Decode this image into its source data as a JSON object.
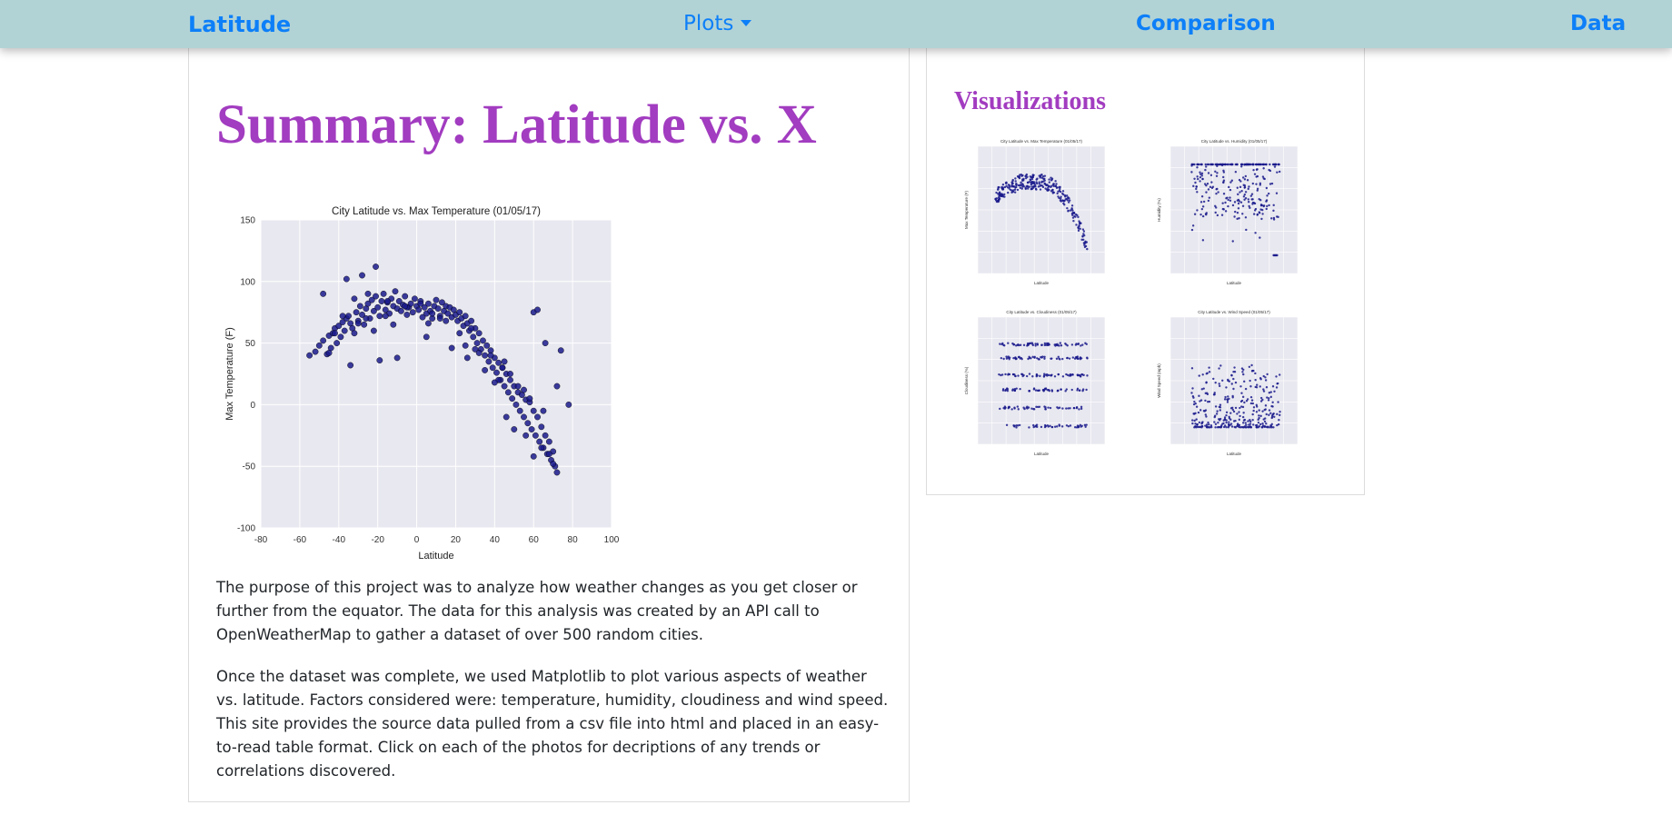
{
  "nav": {
    "brand": "Latitude",
    "plots_label": "Plots",
    "comparison_label": "Comparison",
    "data_label": "Data",
    "link_color": "#0d7ff8",
    "background": "#b2d3d5"
  },
  "summary": {
    "title": "Summary: Latitude vs. X",
    "title_color": "#a23cc0",
    "paragraph1": "The purpose of this project was to analyze how weather changes as you get closer or further from the equator. The data for this analysis was created by an API call to OpenWeatherMap to gather a dataset of over 500 random cities.",
    "paragraph2": "Once the dataset was complete, we used Matplotlib to plot various aspects of weather vs. latitude. Factors considered were: temperature, humidity, cloudiness and wind speed. This site provides the source data pulled from a csv file into html and placed in an easy-to-read table format. Click on each of the photos for decriptions of any trends or correlations discovered."
  },
  "visualizations": {
    "title": "Visualizations"
  },
  "chart_data": [
    {
      "type": "scatter",
      "title": "City Latitude vs. Max Temperature (01/05/17)",
      "xlabel": "Latitude",
      "ylabel": "Max Temperature (F)",
      "xlim": [
        -80,
        100
      ],
      "ylim": [
        -100,
        150
      ],
      "xticks": [
        -80,
        -60,
        -40,
        -20,
        0,
        20,
        40,
        60,
        80,
        100
      ],
      "yticks": [
        -100,
        -50,
        0,
        50,
        100,
        150
      ],
      "grid": true,
      "point_color": "#1a1a8c",
      "plot_background": "#e8e8f0",
      "x": [
        -55,
        -52,
        -50,
        -48,
        -46,
        -45,
        -44,
        -43,
        -42,
        -41,
        -40,
        -39,
        -38,
        -37,
        -36,
        -35,
        -34,
        -33,
        -32,
        -31,
        -30,
        -29,
        -28,
        -27,
        -26,
        -25,
        -24,
        -23,
        -22,
        -21,
        -20,
        -19,
        -18,
        -17,
        -16,
        -15,
        -14,
        -13,
        -12,
        -11,
        -10,
        -9,
        -8,
        -7,
        -6,
        -5,
        -4,
        -3,
        -2,
        -1,
        0,
        1,
        2,
        3,
        4,
        5,
        6,
        7,
        8,
        9,
        10,
        11,
        12,
        13,
        14,
        15,
        16,
        17,
        18,
        19,
        20,
        21,
        22,
        23,
        24,
        25,
        26,
        27,
        28,
        29,
        30,
        31,
        32,
        33,
        34,
        35,
        36,
        37,
        38,
        39,
        40,
        41,
        42,
        43,
        44,
        45,
        46,
        47,
        48,
        49,
        50,
        51,
        52,
        53,
        54,
        55,
        56,
        57,
        58,
        59,
        60,
        61,
        62,
        63,
        64,
        65,
        66,
        67,
        68,
        69,
        70,
        71,
        72,
        -36,
        -28,
        -21,
        -45,
        -34,
        -19,
        -10,
        5,
        25,
        45,
        60,
        62,
        72,
        78,
        55,
        50,
        42,
        35,
        30,
        65,
        68,
        58,
        48,
        38,
        28,
        15,
        8,
        -5,
        -15,
        -25,
        -30,
        -38,
        -42,
        -22,
        -12,
        2,
        12,
        22,
        32,
        44,
        52,
        64,
        70,
        74,
        -48,
        -26,
        -6,
        18,
        40,
        56,
        66,
        -32,
        -16,
        6,
        26,
        46,
        60,
        69
      ],
      "y": [
        40,
        43,
        48,
        52,
        41,
        56,
        46,
        58,
        62,
        50,
        64,
        55,
        67,
        60,
        70,
        72,
        66,
        62,
        58,
        75,
        68,
        80,
        73,
        65,
        78,
        82,
        70,
        85,
        76,
        88,
        79,
        72,
        84,
        90,
        77,
        83,
        74,
        86,
        80,
        92,
        78,
        84,
        76,
        81,
        88,
        73,
        79,
        82,
        75,
        86,
        80,
        77,
        84,
        71,
        79,
        74,
        82,
        76,
        70,
        80,
        85,
        78,
        72,
        83,
        76,
        80,
        74,
        79,
        71,
        77,
        73,
        68,
        75,
        70,
        64,
        72,
        66,
        60,
        68,
        55,
        62,
        50,
        58,
        45,
        52,
        40,
        48,
        35,
        44,
        30,
        38,
        26,
        34,
        20,
        30,
        15,
        25,
        10,
        20,
        5,
        15,
        0,
        10,
        -5,
        8,
        -10,
        4,
        -15,
        2,
        -20,
        -5,
        -25,
        -10,
        -30,
        -18,
        -35,
        -25,
        -40,
        -30,
        -45,
        -38,
        -50,
        -55,
        102,
        105,
        112,
        42,
        32,
        36,
        38,
        55,
        48,
        35,
        75,
        77,
        15,
        0,
        12,
        -20,
        20,
        28,
        45,
        -5,
        -40,
        5,
        25,
        40,
        62,
        68,
        74,
        79,
        84,
        90,
        66,
        72,
        58,
        60,
        65,
        82,
        70,
        58,
        42,
        30,
        15,
        -35,
        -48,
        44,
        90,
        70,
        80,
        46,
        18,
        -25,
        50,
        86,
        72,
        66,
        38,
        -10,
        -42
      ]
    },
    {
      "type": "scatter",
      "title": "City Latitude vs. Max Temperature (01/05/17)",
      "xlabel": "Latitude",
      "ylabel": "Max Temperature (F)",
      "xlim": [
        -80,
        100
      ],
      "ylim": [
        -100,
        150
      ],
      "grid": true
    },
    {
      "type": "scatter",
      "title": "City Latitude vs. Humidity (01/05/17)",
      "xlabel": "Latitude",
      "ylabel": "Humidity (%)",
      "xlim": [
        -80,
        100
      ],
      "ylim": [
        -20,
        120
      ],
      "grid": true
    },
    {
      "type": "scatter",
      "title": "City Latitude vs. Cloudiness (01/05/17)",
      "xlabel": "Latitude",
      "ylabel": "Cloudiness (%)",
      "xlim": [
        -80,
        100
      ],
      "ylim": [
        -20,
        120
      ],
      "grid": true
    },
    {
      "type": "scatter",
      "title": "City Latitude vs. Wind Speed (01/05/17)",
      "xlabel": "Latitude",
      "ylabel": "Wind Speed (mph)",
      "xlim": [
        -80,
        100
      ],
      "ylim": [
        -5,
        40
      ],
      "grid": true
    }
  ]
}
